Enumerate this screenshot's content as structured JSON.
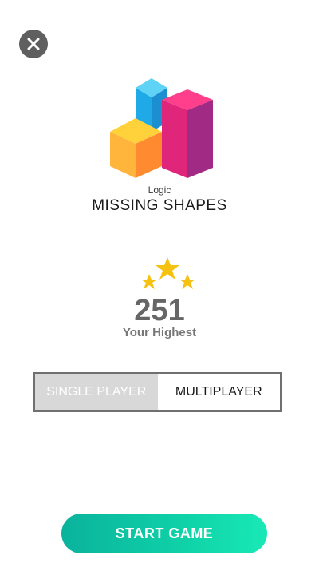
{
  "header": {
    "close_icon": "close-icon"
  },
  "game": {
    "logo_icon": "stacked-cubes-icon",
    "category": "Logic",
    "title": "MISSING SHAPES"
  },
  "score": {
    "stars_icon": "three-stars-icon",
    "value": "251",
    "label": "Your Highest"
  },
  "mode_toggle": {
    "options": [
      {
        "label": "SINGLE PLAYER",
        "selected": false
      },
      {
        "label": "MULTIPLAYER",
        "selected": true
      }
    ]
  },
  "actions": {
    "start_label": "START GAME"
  },
  "colors": {
    "star": "#f5c211",
    "start_gradient": [
      "#0ab39c",
      "#19e9b6"
    ],
    "toggle_inactive_bg": "#d8d8d8",
    "close_bg": "#5f5f5f"
  }
}
